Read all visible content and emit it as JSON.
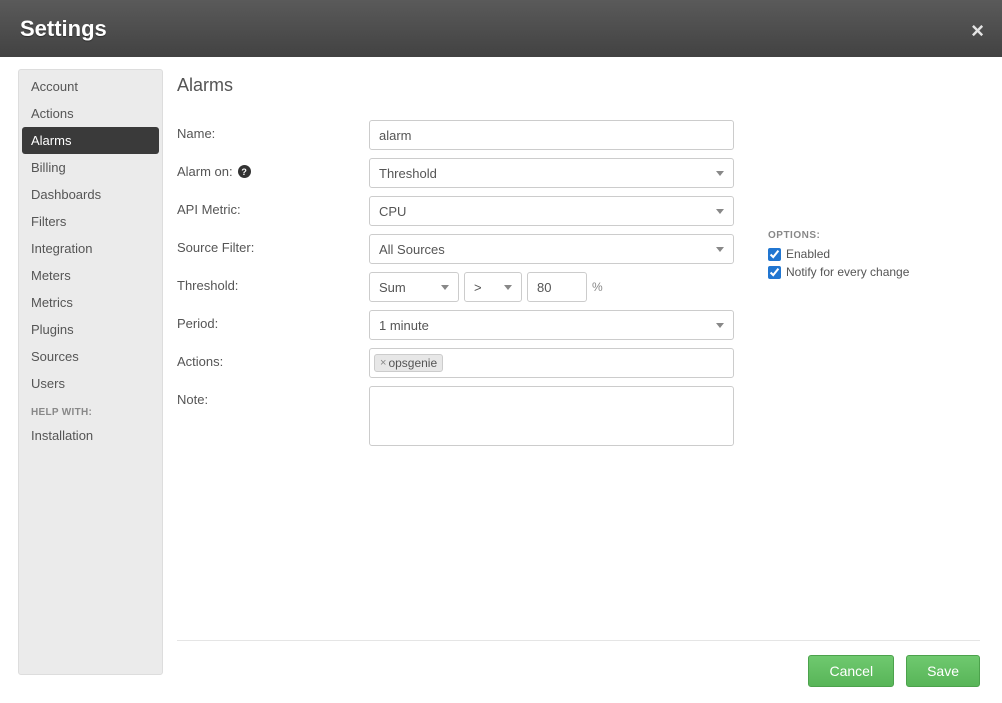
{
  "header": {
    "title": "Settings"
  },
  "sidebar": {
    "items": [
      {
        "label": "Account",
        "active": false
      },
      {
        "label": "Actions",
        "active": false
      },
      {
        "label": "Alarms",
        "active": true
      },
      {
        "label": "Billing",
        "active": false
      },
      {
        "label": "Dashboards",
        "active": false
      },
      {
        "label": "Filters",
        "active": false
      },
      {
        "label": "Integration",
        "active": false
      },
      {
        "label": "Meters",
        "active": false
      },
      {
        "label": "Metrics",
        "active": false
      },
      {
        "label": "Plugins",
        "active": false
      },
      {
        "label": "Sources",
        "active": false
      },
      {
        "label": "Users",
        "active": false
      }
    ],
    "help_heading": "HELP WITH:",
    "help_items": [
      {
        "label": "Installation"
      }
    ]
  },
  "content": {
    "title": "Alarms",
    "labels": {
      "name": "Name:",
      "alarm_on": "Alarm on:",
      "api_metric": "API Metric:",
      "source_filter": "Source Filter:",
      "threshold": "Threshold:",
      "period": "Period:",
      "actions": "Actions:",
      "note": "Note:"
    },
    "values": {
      "name": "alarm",
      "alarm_on": "Threshold",
      "api_metric": "CPU",
      "source_filter": "All Sources",
      "threshold_agg": "Sum",
      "threshold_op": ">",
      "threshold_val": "80",
      "threshold_unit": "%",
      "period": "1 minute",
      "actions_tag": "opsgenie",
      "note": ""
    }
  },
  "options": {
    "heading": "OPTIONS:",
    "items": [
      {
        "label": "Enabled",
        "checked": true
      },
      {
        "label": "Notify for every change",
        "checked": true
      }
    ]
  },
  "footer": {
    "cancel": "Cancel",
    "save": "Save"
  }
}
